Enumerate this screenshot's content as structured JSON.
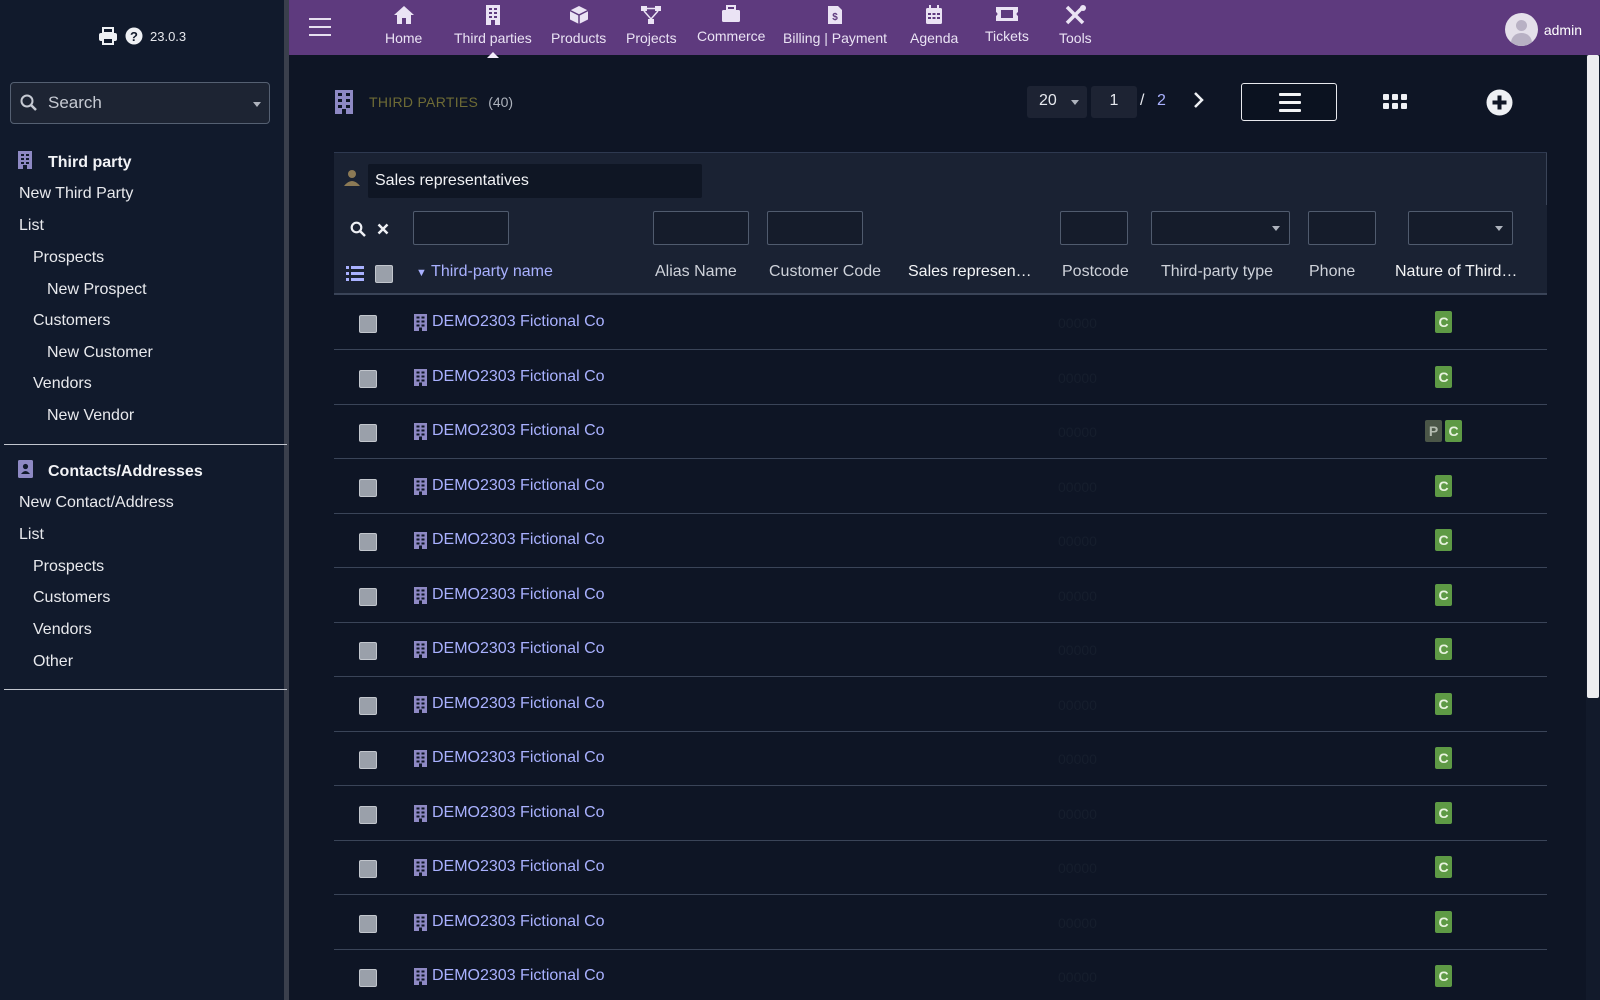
{
  "app": {
    "version": "23.0.3"
  },
  "sidebar": {
    "search_placeholder": "Search",
    "sections": [
      {
        "title": "Third party",
        "icon": "building-icon",
        "items": [
          {
            "label": "New Third Party",
            "level": 0
          },
          {
            "label": "List",
            "level": 0
          },
          {
            "label": "Prospects",
            "level": 1
          },
          {
            "label": "New Prospect",
            "level": 2
          },
          {
            "label": "Customers",
            "level": 1
          },
          {
            "label": "New Customer",
            "level": 2
          },
          {
            "label": "Vendors",
            "level": 1
          },
          {
            "label": "New Vendor",
            "level": 2
          }
        ]
      },
      {
        "title": "Contacts/Addresses",
        "icon": "address-book-icon",
        "items": [
          {
            "label": "New Contact/Address",
            "level": 0
          },
          {
            "label": "List",
            "level": 0
          },
          {
            "label": "Prospects",
            "level": 1
          },
          {
            "label": "Customers",
            "level": 1
          },
          {
            "label": "Vendors",
            "level": 1
          },
          {
            "label": "Other",
            "level": 1
          }
        ]
      }
    ]
  },
  "topnav": {
    "items": [
      {
        "label": "Home",
        "icon": "home-icon",
        "active": false
      },
      {
        "label": "Third parties",
        "icon": "building-icon",
        "active": true
      },
      {
        "label": "Products",
        "icon": "cube-icon",
        "active": false
      },
      {
        "label": "Projects",
        "icon": "project-icon",
        "active": false
      },
      {
        "label": "Commerce",
        "icon": "briefcase-icon",
        "active": false
      },
      {
        "label": "Billing | Payment",
        "icon": "invoice-icon",
        "active": false
      },
      {
        "label": "Agenda",
        "icon": "calendar-icon",
        "active": false
      },
      {
        "label": "Tickets",
        "icon": "ticket-icon",
        "active": false
      },
      {
        "label": "Tools",
        "icon": "tools-icon",
        "active": false
      }
    ],
    "user": "admin"
  },
  "page": {
    "title": "THIRD PARTIES",
    "count": "(40)",
    "limit": "20",
    "page_current": "1",
    "page_separator": "/",
    "page_total": "2"
  },
  "table": {
    "salesrep_filter": "Sales representatives",
    "columns": [
      "Third-party name",
      "Alias Name",
      "Customer Code",
      "Sales represen…",
      "Postcode",
      "Third-party type",
      "Phone",
      "Nature of Third…"
    ],
    "rows": [
      {
        "name": "DEMO2303 Fictional Co",
        "postcode": "00000",
        "badges": [
          "C"
        ]
      },
      {
        "name": "DEMO2303 Fictional Co",
        "postcode": "00000",
        "badges": [
          "C"
        ]
      },
      {
        "name": "DEMO2303 Fictional Co",
        "postcode": "00000",
        "badges": [
          "P",
          "C"
        ]
      },
      {
        "name": "DEMO2303 Fictional Co",
        "postcode": "00000",
        "badges": [
          "C"
        ]
      },
      {
        "name": "DEMO2303 Fictional Co",
        "postcode": "00000",
        "badges": [
          "C"
        ]
      },
      {
        "name": "DEMO2303 Fictional Co",
        "postcode": "00000",
        "badges": [
          "C"
        ]
      },
      {
        "name": "DEMO2303 Fictional Co",
        "postcode": "00000",
        "badges": [
          "C"
        ]
      },
      {
        "name": "DEMO2303 Fictional Co",
        "postcode": "00000",
        "badges": [
          "C"
        ]
      },
      {
        "name": "DEMO2303 Fictional Co",
        "postcode": "00000",
        "badges": [
          "C"
        ]
      },
      {
        "name": "DEMO2303 Fictional Co",
        "postcode": "00000",
        "badges": [
          "C"
        ]
      },
      {
        "name": "DEMO2303 Fictional Co",
        "postcode": "00000",
        "badges": [
          "C"
        ]
      },
      {
        "name": "DEMO2303 Fictional Co",
        "postcode": "00000",
        "badges": [
          "C"
        ]
      },
      {
        "name": "DEMO2303 Fictional Co",
        "postcode": "00000",
        "badges": [
          "C"
        ]
      }
    ]
  },
  "colors": {
    "topbar": "#5e3a7e",
    "sidebar": "#111a2c",
    "background": "#0e1525",
    "link": "#a9b1ff",
    "badge_customer": "#5e9a45",
    "badge_prospect": "#4b5648"
  }
}
